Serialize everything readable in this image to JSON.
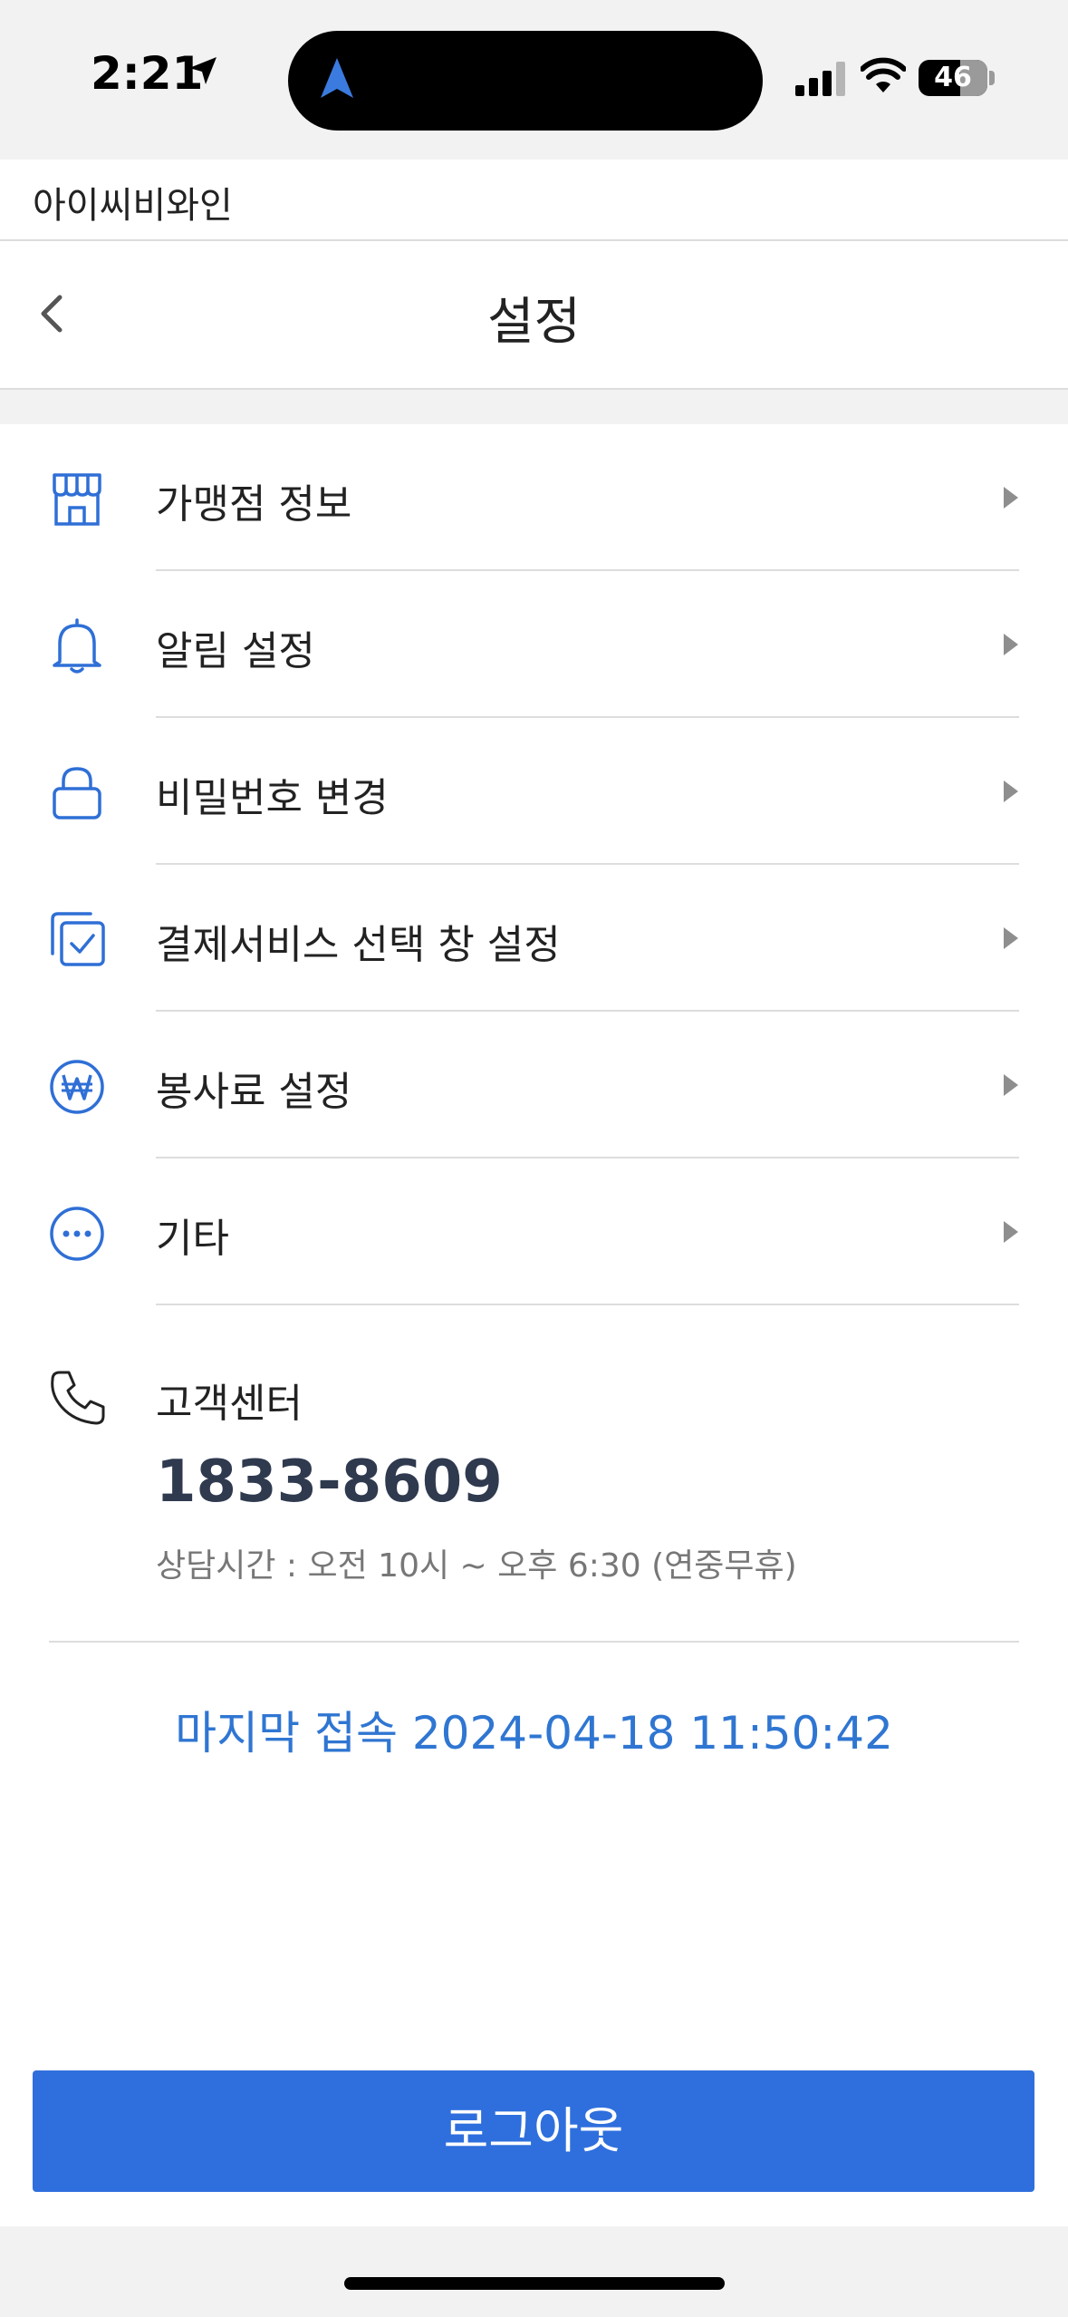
{
  "status_bar": {
    "time": "2:21",
    "battery": "46",
    "icons": [
      "location-arrow-icon",
      "navigation-icon",
      "cellular-signal-icon",
      "wifi-icon",
      "battery-icon"
    ]
  },
  "app_name": "아이씨비와인",
  "header": {
    "title": "설정",
    "back_icon": "chevron-left-icon"
  },
  "menu": {
    "items": [
      {
        "label": "가맹점 정보",
        "icon": "store-icon"
      },
      {
        "label": "알림 설정",
        "icon": "bell-icon"
      },
      {
        "label": "비밀번호 변경",
        "icon": "lock-icon"
      },
      {
        "label": "결제서비스 선택 창 설정",
        "icon": "checkbox-stack-icon"
      },
      {
        "label": "봉사료 설정",
        "icon": "won-coin-icon"
      },
      {
        "label": "기타",
        "icon": "more-dots-icon"
      }
    ],
    "chevron_icon": "triangle-right-icon"
  },
  "support": {
    "label": "고객센터",
    "phone": "1833-8609",
    "hours": "상담시간 : 오전 10시 ~ 오후 6:30 (연중무휴)",
    "icon": "phone-icon"
  },
  "last_login": "마지막 접속 2024-04-18 11:50:42",
  "logout_label": "로그아웃",
  "colors": {
    "accent": "#2e6fdd",
    "icon_blue": "#2f6fd6",
    "last_login_blue": "#2f76d2",
    "phone_text": "#2f3a4f"
  }
}
